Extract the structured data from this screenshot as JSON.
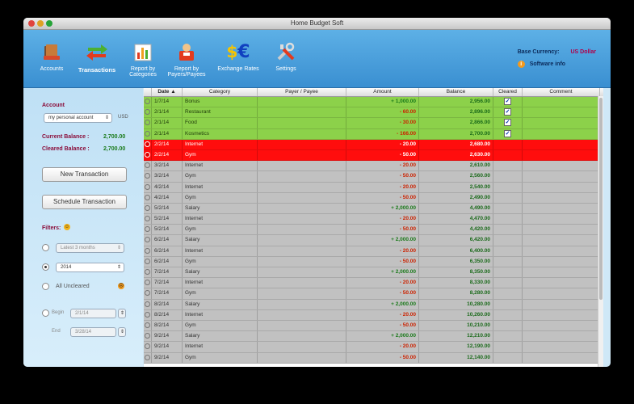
{
  "window": {
    "title": "Home Budget Soft"
  },
  "toolbar": {
    "items": [
      {
        "label": "Accounts",
        "icon": "accounts-icon"
      },
      {
        "label": "Transactions",
        "icon": "transactions-icon",
        "selected": true
      },
      {
        "label": "Report by Categories",
        "icon": "report-categories-icon"
      },
      {
        "label": "Report by Payers/Payees",
        "icon": "report-payers-icon"
      },
      {
        "label": "Exchange Rates",
        "icon": "exchange-rates-icon"
      },
      {
        "label": "Settings",
        "icon": "settings-icon"
      }
    ],
    "report_cat_1": "Report by",
    "report_cat_2": "Categories",
    "report_pay_1": "Report by",
    "report_pay_2": "Payers/Payees",
    "base_currency_label": "Base Currency:",
    "base_currency_value": "US Dollar",
    "software_info": "Software info"
  },
  "sidebar": {
    "account_label": "Account",
    "account_value": "my personal account",
    "account_currency": "USD",
    "current_balance_label": "Current Balance :",
    "current_balance_value": "2,700.00",
    "cleared_balance_label": "Cleared Balance :",
    "cleared_balance_value": "2,700.00",
    "new_transaction": "New Transaction",
    "schedule_transaction": "Schedule Transaction",
    "filters_label": "Filters:",
    "filter_period": "Latest 3 months",
    "filter_year": "2014",
    "all_uncleared": "All Uncleared",
    "begin_label": "Begin",
    "begin_value": "2/1/14",
    "end_label": "End",
    "end_value": "3/28/14"
  },
  "table": {
    "headers": {
      "date": "Date",
      "category": "Category",
      "payer": "Payer / Payee",
      "amount": "Amount",
      "balance": "Balance",
      "cleared": "Cleared",
      "comment": "Comment"
    },
    "rows": [
      {
        "date": "1/7/14",
        "category": "Bonus",
        "amount": "+ 1,000.00",
        "balance": "2,956.00",
        "cleared": true,
        "style": "green"
      },
      {
        "date": "2/1/14",
        "category": "Restaurant",
        "amount": "- 60.00",
        "balance": "2,896.00",
        "cleared": true,
        "style": "green"
      },
      {
        "date": "2/1/14",
        "category": "Food",
        "amount": "- 30.00",
        "balance": "2,866.00",
        "cleared": true,
        "style": "green"
      },
      {
        "date": "2/1/14",
        "category": "Kosmetics",
        "amount": "- 166.00",
        "balance": "2,700.00",
        "cleared": true,
        "style": "green"
      },
      {
        "date": "2/2/14",
        "category": "Internet",
        "amount": "- 20.00",
        "balance": "2,680.00",
        "cleared": false,
        "style": "red"
      },
      {
        "date": "2/2/14",
        "category": "Gym",
        "amount": "- 50.00",
        "balance": "2,630.00",
        "cleared": false,
        "style": "red"
      },
      {
        "date": "3/2/14",
        "category": "Internet",
        "amount": "- 20.00",
        "balance": "2,610.00",
        "cleared": false,
        "style": "gray"
      },
      {
        "date": "3/2/14",
        "category": "Gym",
        "amount": "- 50.00",
        "balance": "2,560.00",
        "cleared": false,
        "style": "gray"
      },
      {
        "date": "4/2/14",
        "category": "Internet",
        "amount": "- 20.00",
        "balance": "2,540.00",
        "cleared": false,
        "style": "gray"
      },
      {
        "date": "4/2/14",
        "category": "Gym",
        "amount": "- 50.00",
        "balance": "2,490.00",
        "cleared": false,
        "style": "gray"
      },
      {
        "date": "5/2/14",
        "category": "Salary",
        "amount": "+ 2,000.00",
        "balance": "4,490.00",
        "cleared": false,
        "style": "gray"
      },
      {
        "date": "5/2/14",
        "category": "Internet",
        "amount": "- 20.00",
        "balance": "4,470.00",
        "cleared": false,
        "style": "gray"
      },
      {
        "date": "5/2/14",
        "category": "Gym",
        "amount": "- 50.00",
        "balance": "4,420.00",
        "cleared": false,
        "style": "gray"
      },
      {
        "date": "6/2/14",
        "category": "Salary",
        "amount": "+ 2,000.00",
        "balance": "6,420.00",
        "cleared": false,
        "style": "gray"
      },
      {
        "date": "6/2/14",
        "category": "Internet",
        "amount": "- 20.00",
        "balance": "6,400.00",
        "cleared": false,
        "style": "gray"
      },
      {
        "date": "6/2/14",
        "category": "Gym",
        "amount": "- 50.00",
        "balance": "6,350.00",
        "cleared": false,
        "style": "gray"
      },
      {
        "date": "7/2/14",
        "category": "Salary",
        "amount": "+ 2,000.00",
        "balance": "8,350.00",
        "cleared": false,
        "style": "gray"
      },
      {
        "date": "7/2/14",
        "category": "Internet",
        "amount": "- 20.00",
        "balance": "8,330.00",
        "cleared": false,
        "style": "gray"
      },
      {
        "date": "7/2/14",
        "category": "Gym",
        "amount": "- 50.00",
        "balance": "8,280.00",
        "cleared": false,
        "style": "gray"
      },
      {
        "date": "8/2/14",
        "category": "Salary",
        "amount": "+ 2,000.00",
        "balance": "10,280.00",
        "cleared": false,
        "style": "gray"
      },
      {
        "date": "8/2/14",
        "category": "Internet",
        "amount": "- 20.00",
        "balance": "10,260.00",
        "cleared": false,
        "style": "gray"
      },
      {
        "date": "8/2/14",
        "category": "Gym",
        "amount": "- 50.00",
        "balance": "10,210.00",
        "cleared": false,
        "style": "gray"
      },
      {
        "date": "9/2/14",
        "category": "Salary",
        "amount": "+ 2,000.00",
        "balance": "12,210.00",
        "cleared": false,
        "style": "gray"
      },
      {
        "date": "9/2/14",
        "category": "Internet",
        "amount": "- 20.00",
        "balance": "12,190.00",
        "cleared": false,
        "style": "gray"
      },
      {
        "date": "9/2/14",
        "category": "Gym",
        "amount": "- 50.00",
        "balance": "12,140.00",
        "cleared": false,
        "style": "gray"
      }
    ]
  },
  "colors": {
    "green_row": "#8cd14a",
    "red_row": "#ff0d0d",
    "gray_row": "#c1c1c1",
    "toolbar": "#4aa0dc"
  }
}
